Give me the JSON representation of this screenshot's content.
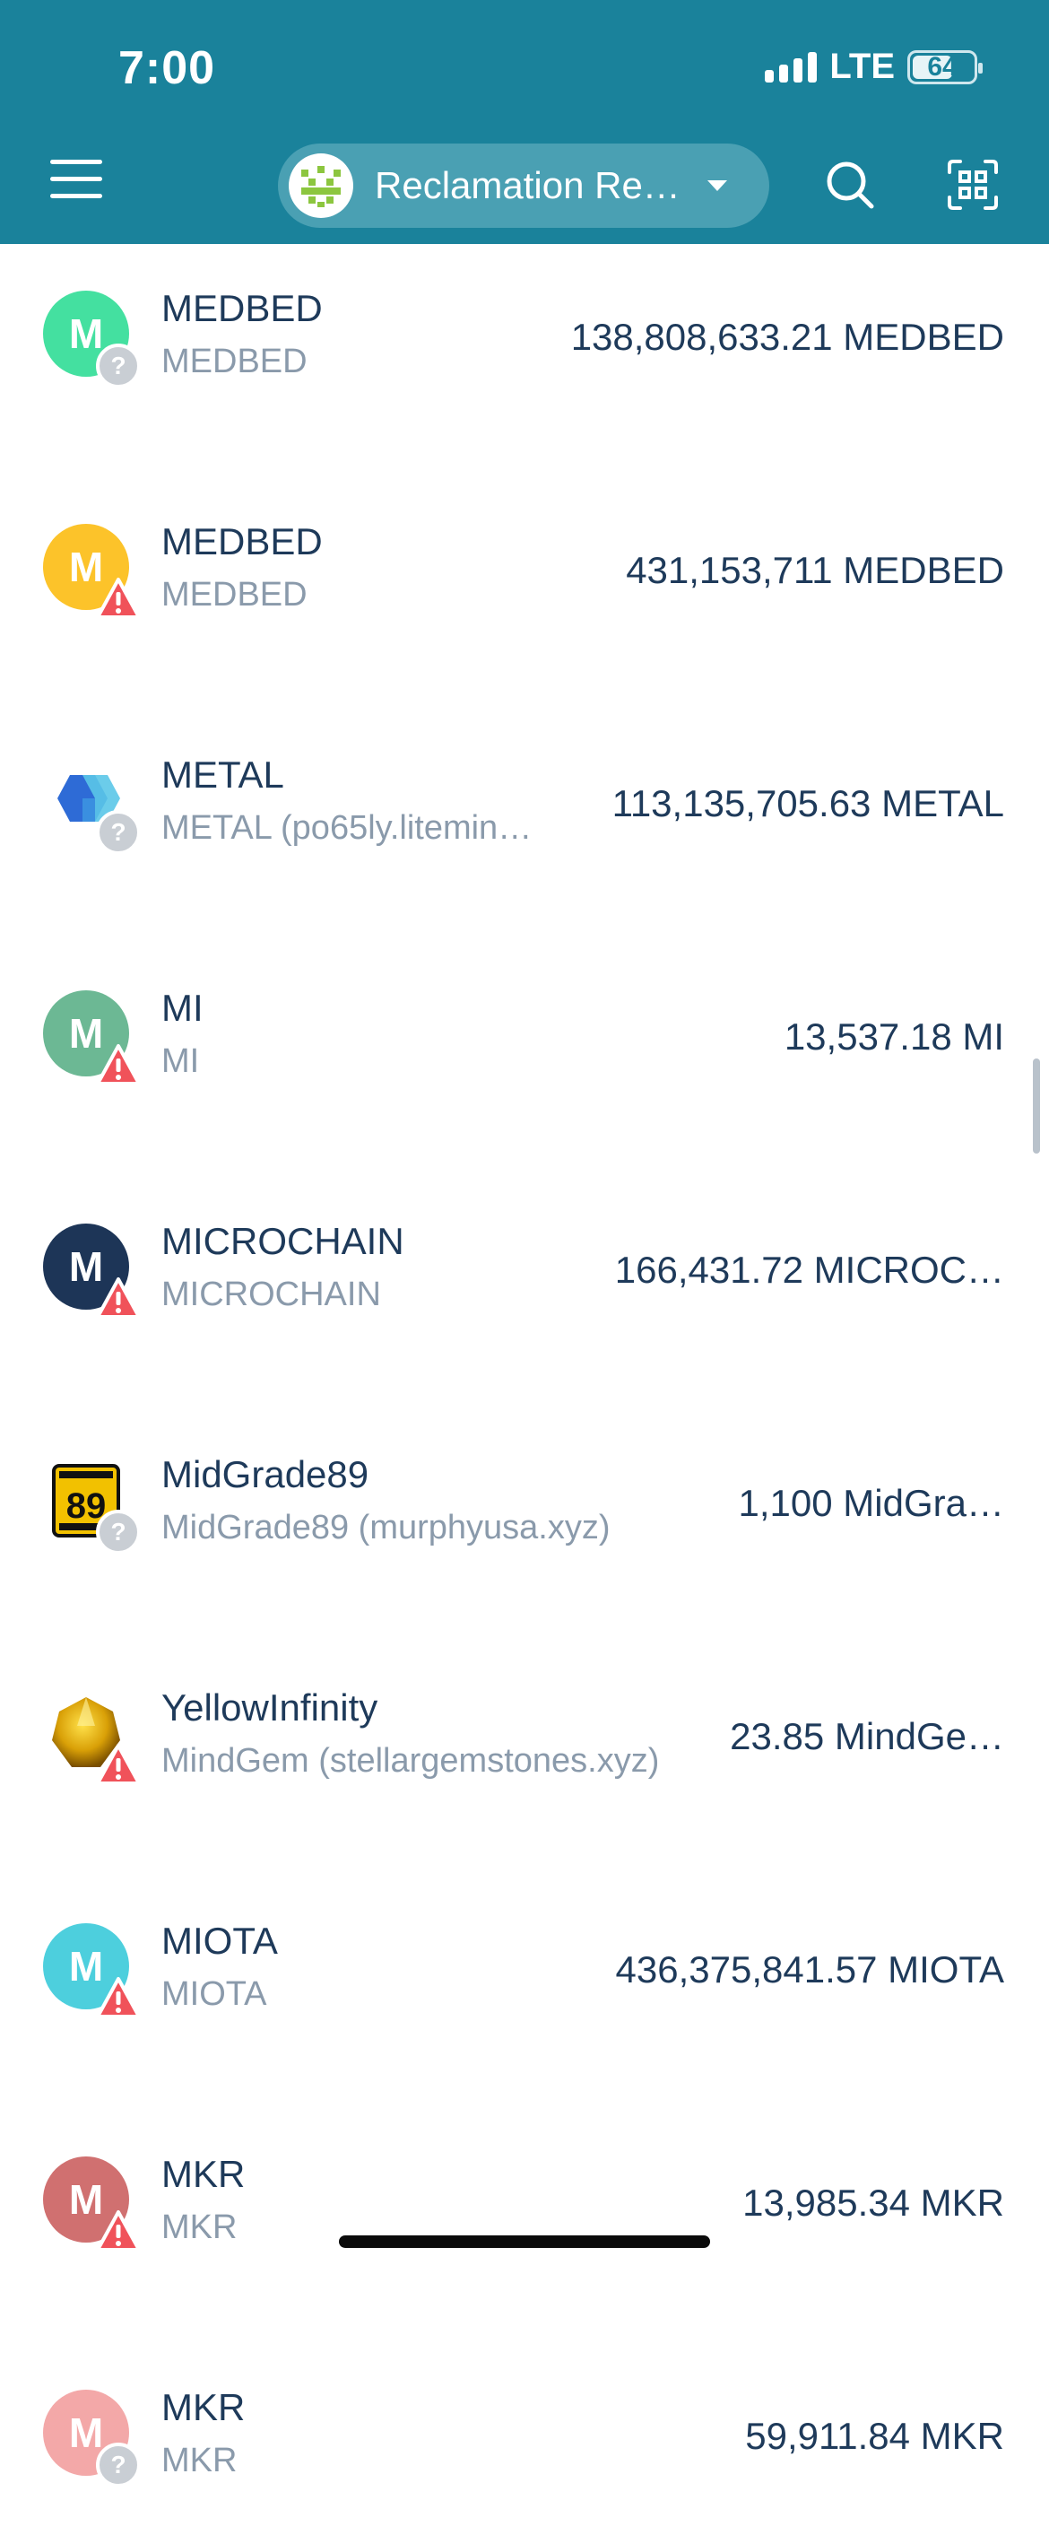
{
  "status": {
    "time": "7:00",
    "network": "LTE",
    "battery": "64",
    "battery_level": 0.64
  },
  "header": {
    "wallet_name": "Reclamation Re…",
    "menu_icon": "hamburger-icon",
    "search_icon": "search-icon",
    "scan_icon": "scan-icon"
  },
  "tokens": [
    {
      "name": "MEDBED",
      "sub": "MEDBED",
      "balance": "138,808,633.21 MEDBED",
      "letter": "M",
      "color": "#44e0a0",
      "badge": "question"
    },
    {
      "name": "MEDBED",
      "sub": "MEDBED",
      "balance": "431,153,711 MEDBED",
      "letter": "M",
      "color": "#fcc32a",
      "badge": "warning"
    },
    {
      "name": "METAL",
      "sub": "METAL (po65ly.litemin…",
      "balance": "113,135,705.63 METAL",
      "letter": "",
      "color": "#2e6bd6",
      "badge": "question"
    },
    {
      "name": "MI",
      "sub": "MI",
      "balance": "13,537.18 MI",
      "letter": "M",
      "color": "#6cb894",
      "badge": "warning"
    },
    {
      "name": "MICROCHAIN",
      "sub": "MICROCHAIN",
      "balance": "166,431.72 MICROC…",
      "letter": "M",
      "color": "#1d3557",
      "badge": "warning"
    },
    {
      "name": "MidGrade89",
      "sub": "MidGrade89 (murphyusa.xyz)",
      "balance": "1,100 MidGra…",
      "letter": "",
      "color": "#f2c100",
      "badge": "question"
    },
    {
      "name": "YellowInfinity",
      "sub": "MindGem (stellargemstones.xyz)",
      "balance": "23.85 MindGe…",
      "letter": "",
      "color": "#d9a007",
      "badge": "warning"
    },
    {
      "name": "MIOTA",
      "sub": "MIOTA",
      "balance": "436,375,841.57 MIOTA",
      "letter": "M",
      "color": "#4dcfdd",
      "badge": "warning"
    },
    {
      "name": "MKR",
      "sub": "MKR",
      "balance": "13,985.34 MKR",
      "letter": "M",
      "color": "#d07070",
      "badge": "warning"
    },
    {
      "name": "MKR",
      "sub": "MKR",
      "balance": "59,911.84 MKR",
      "letter": "M",
      "color": "#f3a8a8",
      "badge": "question"
    }
  ],
  "midgrade_icon_text": "89",
  "colors": {
    "header": "#1a829b",
    "pill": "#4aa0b3",
    "text": "#1e3a5a",
    "subtext": "#8a9aab",
    "warning": "#f0525a",
    "question": "#c9ced4"
  }
}
